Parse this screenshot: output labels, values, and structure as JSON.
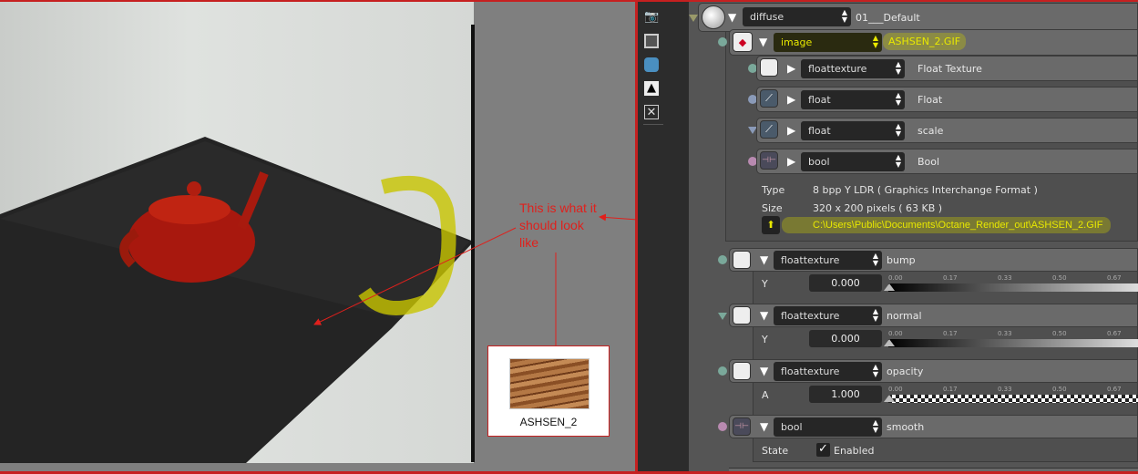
{
  "annotation": {
    "note_lines": [
      "This is what it",
      "should look",
      "like"
    ],
    "thumbnail_caption": "ASHSEN_2"
  },
  "icons": [
    "camera-icon",
    "film-icon",
    "database-icon",
    "image-icon",
    "texture-icon"
  ],
  "diffuse": {
    "type": "diffuse",
    "name": "01___Default"
  },
  "image": {
    "type": "image",
    "name": "ASHSEN_2.GIF",
    "children": [
      {
        "type": "floattexture",
        "label": "Float Texture"
      },
      {
        "type": "float",
        "label": "Float"
      },
      {
        "type": "float",
        "label": "scale"
      },
      {
        "type": "bool",
        "label": "Bool"
      }
    ],
    "type_label": "Type",
    "type_value": "8 bpp Y LDR ( Graphics Interchange Format )",
    "size_label": "Size",
    "size_value": "320 x 200 pixels ( 63 KB )",
    "path": "C:\\Users\\Public\\Documents\\Octane_Render_out\\ASHSEN_2.GIF"
  },
  "params": [
    {
      "type": "floattexture",
      "name": "bump",
      "field": "Y",
      "value": "0.000"
    },
    {
      "type": "floattexture",
      "name": "normal",
      "field": "Y",
      "value": "0.000"
    },
    {
      "type": "floattexture",
      "name": "opacity",
      "field": "A",
      "value": "1.000"
    }
  ],
  "smooth": {
    "type": "bool",
    "name": "smooth",
    "field": "State",
    "checkbox_label": "Enabled",
    "checked": true
  },
  "ramp_ticks": [
    "0.00",
    "0.17",
    "0.33",
    "0.50",
    "0.67"
  ],
  "colors": {
    "highlight": "#e8e800",
    "annotation": "#e0201c"
  }
}
